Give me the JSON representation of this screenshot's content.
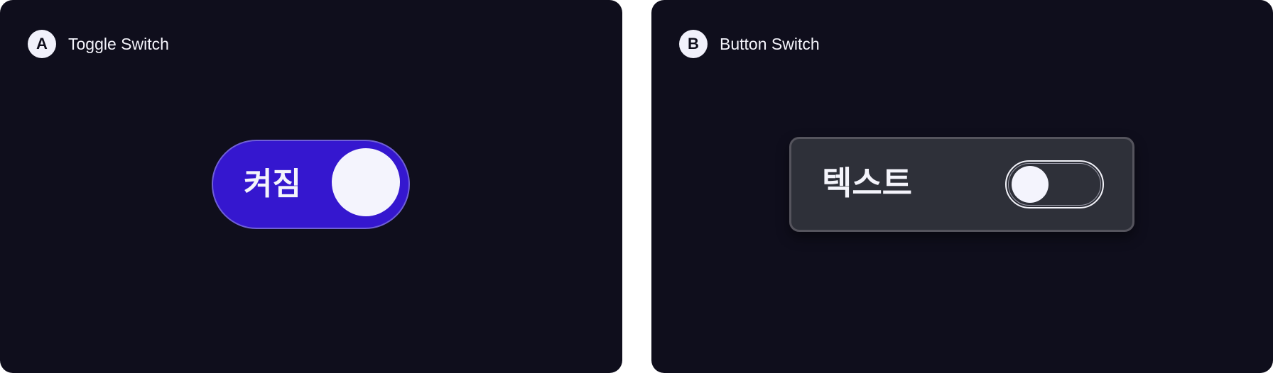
{
  "panels": [
    {
      "badge": "A",
      "title": "Toggle Switch",
      "control": {
        "type": "toggle-switch",
        "label": "켜짐",
        "state": "on",
        "track_color": "#3517cf",
        "knob_color": "#f4f4fd"
      }
    },
    {
      "badge": "B",
      "title": "Button Switch",
      "control": {
        "type": "button-switch",
        "label": "텍스트",
        "state": "off",
        "background_color": "#2e3039",
        "border_color": "#55545d"
      }
    }
  ]
}
